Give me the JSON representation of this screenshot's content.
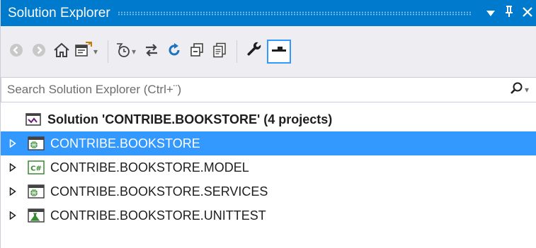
{
  "panel": {
    "title": "Solution Explorer",
    "title_buttons": [
      {
        "name": "options-dropdown",
        "glyph": "▼"
      },
      {
        "name": "pin",
        "glyph": "ᵖ"
      },
      {
        "name": "close",
        "glyph": "✕"
      }
    ]
  },
  "toolbar": {
    "buttons": [
      {
        "name": "back-button",
        "icon": "back-circle-icon"
      },
      {
        "name": "forward-button",
        "icon": "forward-circle-icon"
      },
      {
        "name": "home-button",
        "icon": "home-icon"
      },
      {
        "name": "switch-views-button",
        "icon": "switch-views-icon",
        "dropdown": true
      },
      {
        "name": "pending-changes-filter-button",
        "icon": "pending-changes-icon",
        "dropdown": true
      },
      {
        "name": "sync-active-document-button",
        "icon": "sync-arrows-icon"
      },
      {
        "name": "refresh-button",
        "icon": "refresh-icon"
      },
      {
        "name": "collapse-all-button",
        "icon": "collapse-all-icon"
      },
      {
        "name": "show-all-files-button",
        "icon": "show-all-files-icon"
      },
      {
        "name": "properties-button",
        "icon": "wrench-icon"
      },
      {
        "name": "preview-selected-items-button",
        "icon": "preview-icon",
        "active": true
      }
    ]
  },
  "search": {
    "placeholder": "Search Solution Explorer (Ctrl+¨)",
    "value": ""
  },
  "tree": {
    "solution": {
      "label": "Solution 'CONTRIBE.BOOKSTORE' (4 projects)",
      "icon": "solution-icon"
    },
    "projects": [
      {
        "label": "CONTRIBE.BOOKSTORE",
        "icon": "web-project-icon",
        "selected": true
      },
      {
        "label": "CONTRIBE.BOOKSTORE.MODEL",
        "icon": "csharp-project-icon",
        "selected": false
      },
      {
        "label": "CONTRIBE.BOOKSTORE.SERVICES",
        "icon": "web-project-icon",
        "selected": false
      },
      {
        "label": "CONTRIBE.BOOKSTORE.UNITTEST",
        "icon": "test-project-icon",
        "selected": false
      }
    ]
  },
  "colors": {
    "accent": "#007acc",
    "selection": "#3399ff",
    "toolbar_bg": "#eeeef2",
    "border": "#cccedb"
  }
}
